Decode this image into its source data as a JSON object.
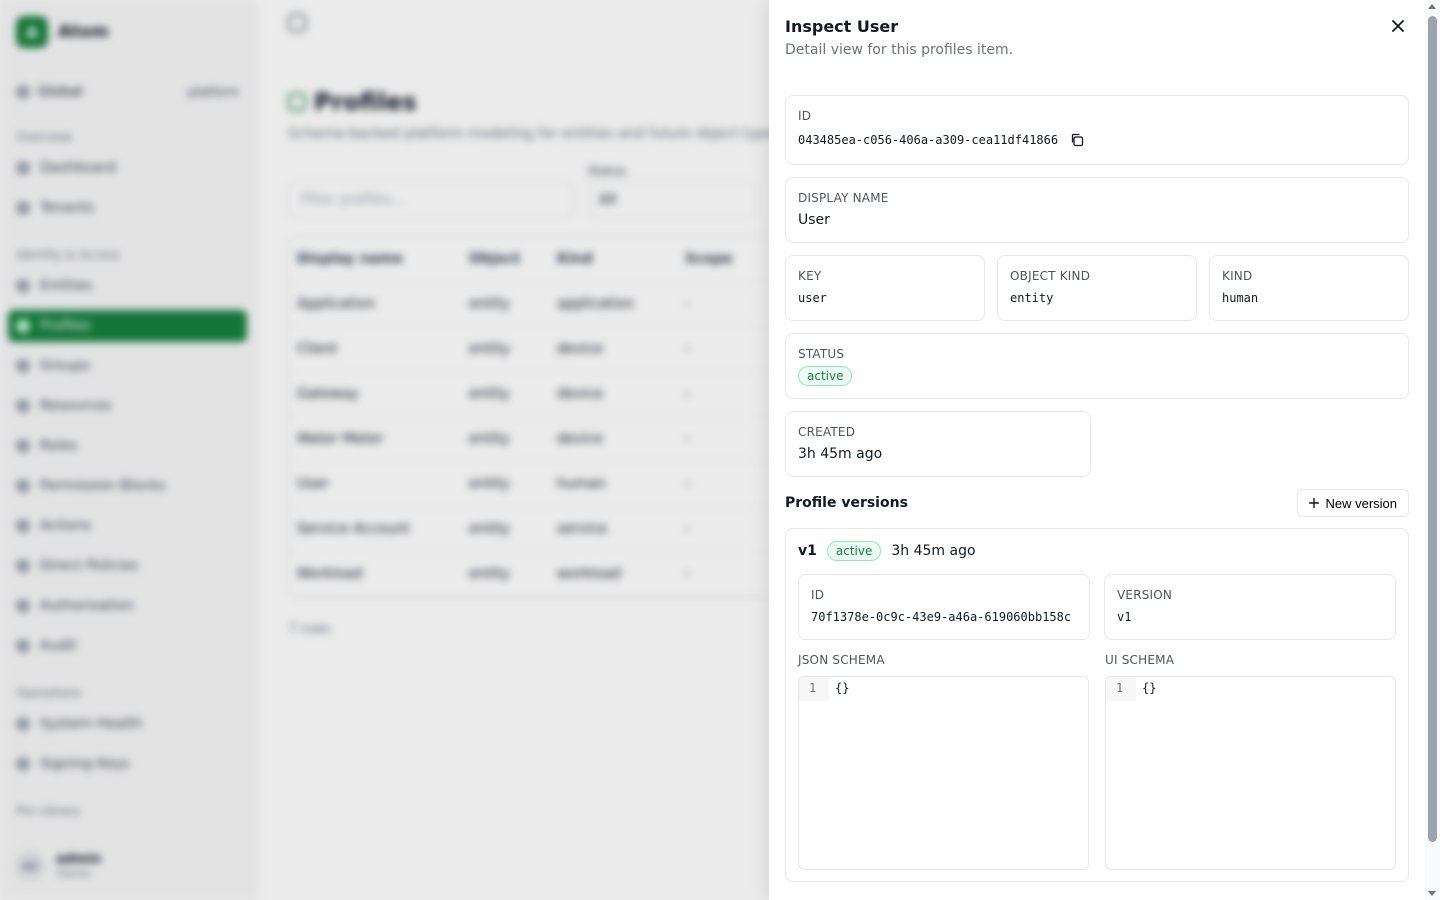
{
  "background": {
    "brand": {
      "name": "Atom",
      "mark": "A"
    },
    "scope": {
      "label": "Global",
      "tenant": "platform"
    },
    "nav": {
      "sections": [
        {
          "title": "Overview",
          "items": [
            "Dashboard",
            "Tenants"
          ]
        },
        {
          "title": "Identity & Access",
          "items": [
            "Entities",
            "Profiles",
            "Groups",
            "Resources",
            "Roles",
            "Permission Blocks",
            "Actions",
            "Direct Policies",
            "Authorization",
            "Audit"
          ]
        },
        {
          "title": "Operations",
          "items": [
            "System Health",
            "Signing Keys"
          ]
        }
      ],
      "active_item": "Profiles",
      "footer_section": "Pro Library"
    },
    "user": {
      "initials": "AD",
      "name": "admin",
      "role": "Owner"
    },
    "page": {
      "title": "Profiles",
      "subtitle": "Schema-backed platform modeling for entities and future object types.",
      "filter_placeholder": "Filter profiles...",
      "status_label": "Status",
      "status_value": "All",
      "columns": [
        "Display name",
        "Object",
        "Kind",
        "Scope"
      ],
      "rows": [
        [
          "Application",
          "entity",
          "application",
          "-"
        ],
        [
          "Client",
          "entity",
          "device",
          "-"
        ],
        [
          "Gateway",
          "entity",
          "device",
          "-"
        ],
        [
          "Water Meter",
          "entity",
          "device",
          "-"
        ],
        [
          "User",
          "entity",
          "human",
          "-"
        ],
        [
          "Service Account",
          "entity",
          "service",
          "-"
        ],
        [
          "Workload",
          "entity",
          "workload",
          "-"
        ]
      ],
      "row_count": "7 rows"
    }
  },
  "panel": {
    "title": "Inspect User",
    "description": "Detail view for this profiles item.",
    "close_icon": "close-icon",
    "fields": {
      "id": {
        "label": "ID",
        "value": "043485ea-c056-406a-a309-cea11df41866"
      },
      "display_name": {
        "label": "Display Name",
        "value": "User"
      },
      "key": {
        "label": "Key",
        "value": "user"
      },
      "object_kind": {
        "label": "Object Kind",
        "value": "entity"
      },
      "kind": {
        "label": "Kind",
        "value": "human"
      },
      "status": {
        "label": "Status",
        "value": "active"
      },
      "created": {
        "label": "Created",
        "value": "3h 45m ago"
      }
    },
    "versions": {
      "title": "Profile versions",
      "new_button": "New version",
      "items": [
        {
          "name": "v1",
          "status": "active",
          "time": "3h 45m ago",
          "id_label": "ID",
          "id": "70f1378e-0c9c-43e9-a46a-619060bb158c",
          "version_label": "Version",
          "version": "v1",
          "json_schema_label": "JSON Schema",
          "json_schema_line": "1",
          "json_schema": "{}",
          "ui_schema_label": "UI Schema",
          "ui_schema_line": "1",
          "ui_schema": "{}"
        }
      ]
    }
  },
  "colors": {
    "accent": "#15803d",
    "badge_bg": "#ecfdf3",
    "badge_border": "#86efac",
    "border": "#e5e7eb"
  }
}
